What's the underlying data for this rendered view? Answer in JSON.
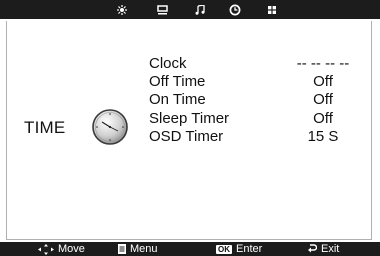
{
  "top_tabs": [
    {
      "icon": "picture-icon",
      "selected": false
    },
    {
      "icon": "screen-icon",
      "selected": false
    },
    {
      "icon": "music-note-icon",
      "selected": false
    },
    {
      "icon": "clock-tab-icon",
      "selected": true
    },
    {
      "icon": "setup-grid-icon",
      "selected": false
    }
  ],
  "category": {
    "label": "TIME",
    "icon": "analog-clock-icon"
  },
  "items": [
    {
      "label": "Clock",
      "value": "-- -- -- --"
    },
    {
      "label": "Off Time",
      "value": "Off"
    },
    {
      "label": "On Time",
      "value": "Off"
    },
    {
      "label": "Sleep Timer",
      "value": "Off"
    },
    {
      "label": "OSD Timer",
      "value": "15 S"
    }
  ],
  "footer": {
    "move": "Move",
    "menu": "Menu",
    "ok_badge": "OK",
    "enter": "Enter",
    "exit": "Exit"
  },
  "colors": {
    "bar": "#1c1c1c",
    "background": "#ffffff",
    "text": "#111111"
  }
}
